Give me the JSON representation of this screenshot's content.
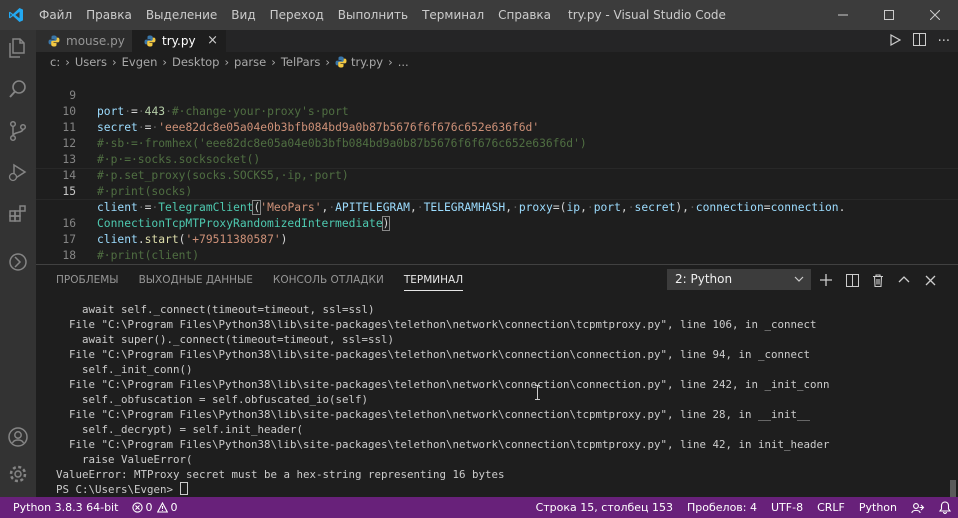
{
  "window": {
    "title": "try.py - Visual Studio Code",
    "menu": [
      "Файл",
      "Правка",
      "Выделение",
      "Вид",
      "Переход",
      "Выполнить",
      "Терминал",
      "Справка"
    ]
  },
  "tabs": [
    {
      "label": "mouse.py",
      "active": false
    },
    {
      "label": "try.py",
      "active": true
    }
  ],
  "breadcrumb": [
    "c:",
    "Users",
    "Evgen",
    "Desktop",
    "parse",
    "TelPars",
    "try.py",
    "..."
  ],
  "editor": {
    "lines": [
      {
        "num": "9",
        "text": "port = 443 # change your proxy's port"
      },
      {
        "num": "10",
        "text": "secret = 'eee82dc8e05a04e0b3bfb084bd9a0b87b5676f6f676c652e636f6d'"
      },
      {
        "num": "11",
        "text": "# sb = fromhex('eee82dc8e05a04e0b3bfb084bd9a0b87b5676f6f676c652e636f6d')"
      },
      {
        "num": "12",
        "text": "# p = socks.socksocket()"
      },
      {
        "num": "13",
        "text": "# p.set_proxy(socks.SOCKS5, ip, port)"
      },
      {
        "num": "14",
        "text": "# print(socks)"
      },
      {
        "num": "15",
        "text": "client = TelegramClient('MeoPars', APITELEGRAM, TELEGRAMHASH, proxy=(ip, port, secret), connection=connection."
      },
      {
        "num": "",
        "text": "ConnectionTcpMTProxyRandomizedIntermediate)"
      },
      {
        "num": "16",
        "text": "client.start('+79511380587')"
      },
      {
        "num": "17",
        "text": "# print(client)"
      },
      {
        "num": "18",
        "text": ""
      }
    ]
  },
  "panel": {
    "tabs": [
      "ПРОБЛЕМЫ",
      "ВЫХОДНЫЕ ДАННЫЕ",
      "КОНСОЛЬ ОТЛАДКИ",
      "ТЕРМИНАЛ"
    ],
    "active_tab": "ТЕРМИНАЛ",
    "terminal_select": "2: Python",
    "terminal_lines": [
      "    await self._connect(timeout=timeout, ssl=ssl)",
      "  File \"C:\\Program Files\\Python38\\lib\\site-packages\\telethon\\network\\connection\\tcpmtproxy.py\", line 106, in _connect",
      "    await super()._connect(timeout=timeout, ssl=ssl)",
      "  File \"C:\\Program Files\\Python38\\lib\\site-packages\\telethon\\network\\connection\\connection.py\", line 94, in _connect",
      "    self._init_conn()",
      "  File \"C:\\Program Files\\Python38\\lib\\site-packages\\telethon\\network\\connection\\connection.py\", line 242, in _init_conn",
      "    self._obfuscation = self.obfuscated_io(self)",
      "  File \"C:\\Program Files\\Python38\\lib\\site-packages\\telethon\\network\\connection\\tcpmtproxy.py\", line 28, in __init__",
      "    self._decrypt) = self.init_header(",
      "  File \"C:\\Program Files\\Python38\\lib\\site-packages\\telethon\\network\\connection\\tcpmtproxy.py\", line 42, in init_header",
      "    raise ValueError(",
      "ValueError: MTProxy secret must be a hex-string representing 16 bytes"
    ],
    "prompt": "PS C:\\Users\\Evgen> "
  },
  "statusbar": {
    "interpreter": "Python 3.8.3 64-bit",
    "errors": "0",
    "warnings": "0",
    "position": "Строка 15, столбец 153",
    "spaces": "Пробелов: 4",
    "encoding": "UTF-8",
    "eol": "CRLF",
    "language": "Python"
  },
  "colors": {
    "statusbar": "#68217a",
    "accent": "#007acc"
  }
}
